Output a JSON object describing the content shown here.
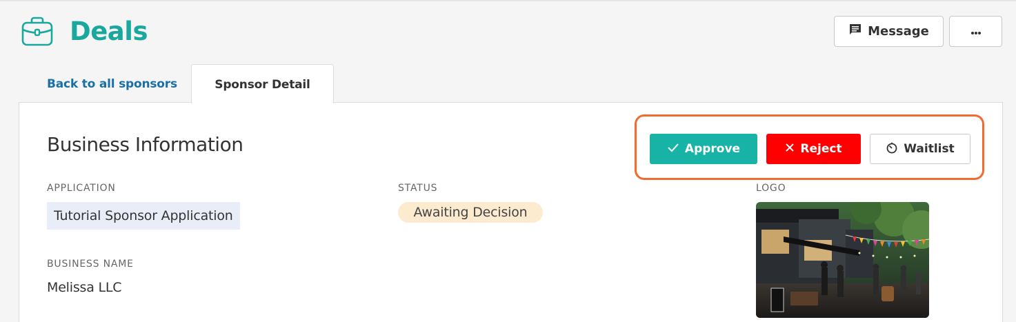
{
  "header": {
    "title": "Deals",
    "icon": "briefcase-icon",
    "message_label": "Message",
    "message_icon": "message-icon",
    "more_icon": "more-horizontal-icon"
  },
  "tabs": {
    "back_label": "Back to all sponsors",
    "detail_label": "Sponsor Detail"
  },
  "section": {
    "title": "Business Information"
  },
  "actions": {
    "approve_label": "Approve",
    "reject_label": "Reject",
    "waitlist_label": "Waitlist"
  },
  "fields": {
    "application_label": "APPLICATION",
    "application_value": "Tutorial Sponsor Application",
    "status_label": "STATUS",
    "status_value": "Awaiting Decision",
    "logo_label": "LOGO",
    "business_name_label": "BUSINESS NAME",
    "business_name_value": "Melissa LLC"
  },
  "colors": {
    "brand": "#1aa89e",
    "approve": "#18b3a7",
    "reject": "#ff0000",
    "highlight": "#f26b2e",
    "link": "#1a6fa8",
    "status_bg": "#fdebd0",
    "chip_bg": "#e8edf8"
  }
}
